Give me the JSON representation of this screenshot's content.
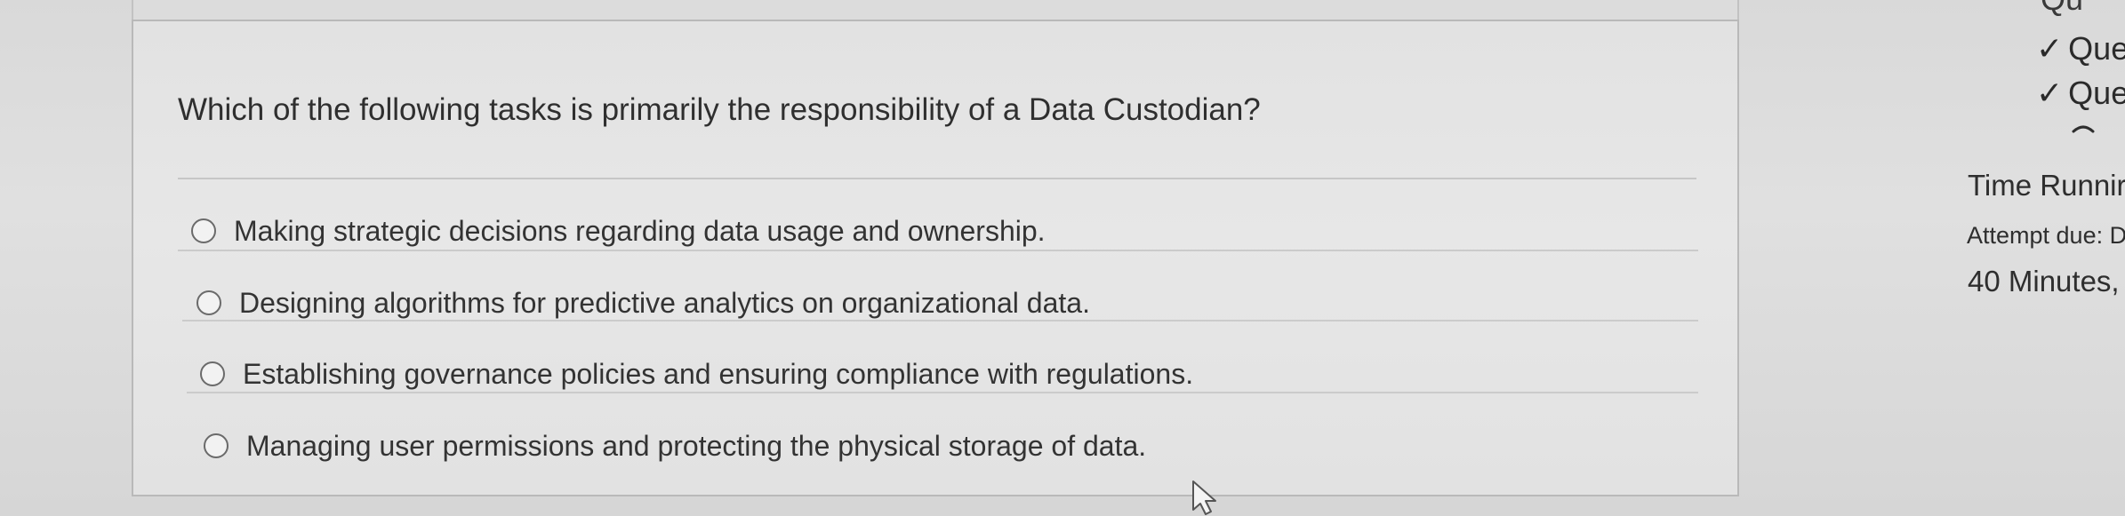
{
  "question": {
    "text": "Which of the following tasks is primarily the responsibility of a Data Custodian?",
    "options": [
      {
        "label": "Making strategic decisions regarding data usage and ownership."
      },
      {
        "label": "Designing algorithms for predictive analytics on organizational data."
      },
      {
        "label": "Establishing governance policies and ensuring compliance with regulations."
      },
      {
        "label": "Managing user permissions and protecting the physical storage of data."
      }
    ]
  },
  "sidebar": {
    "partial_top": "Qu",
    "question_links": [
      {
        "label": "Que"
      },
      {
        "label": "Que"
      }
    ],
    "timer_title": "Time Runnir",
    "attempt_due": "Attempt due: D",
    "time_left": "40 Minutes,"
  },
  "icons": {
    "answered": "check-icon",
    "collapse": "chevron-up-icon",
    "option": "radio-button-icon",
    "pointer": "mouse-cursor-icon"
  }
}
